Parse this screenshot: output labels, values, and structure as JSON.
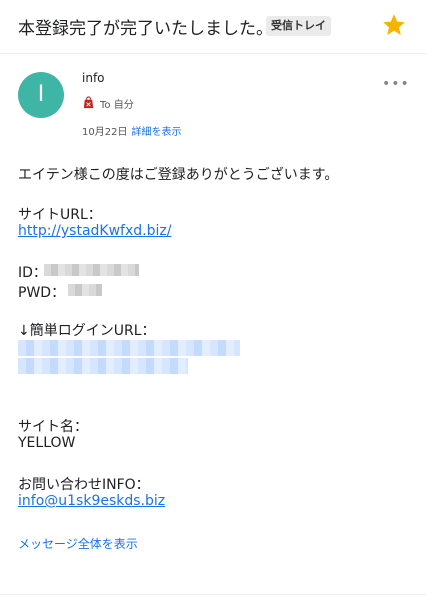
{
  "header": {
    "subject": "本登録完了が完了いたしました。",
    "label": "受信トレイ",
    "star_icon": "star-icon",
    "star_color": "#f4b400"
  },
  "message": {
    "avatar_letter": "I",
    "avatar_color": "#3fb5a6",
    "sender_name": "info",
    "to_icon": "bag-icon",
    "to_text": "To 自分",
    "date": "10月22日",
    "details_link": "詳細を表示",
    "more_icon": "more-icon",
    "more_text": "•••"
  },
  "body": {
    "greeting": "エイテン様この度はご登録ありがとうございます。",
    "site_url_label": "サイトURL：",
    "site_url": "http://ystadKwfxd.biz/",
    "id_label": "ID：",
    "pwd_label": "PWD：",
    "login_url_label": "↓簡単ログインURL：",
    "site_name_label": "サイト名：",
    "site_name": "YELLOW",
    "contact_label": "お問い合わせINFO：",
    "contact_email": "info@u1sk9eskds.biz"
  },
  "footer": {
    "show_all": "メッセージ全体を表示"
  },
  "colors": {
    "link": "#1a73e8",
    "accent_red": "#c5221f"
  }
}
